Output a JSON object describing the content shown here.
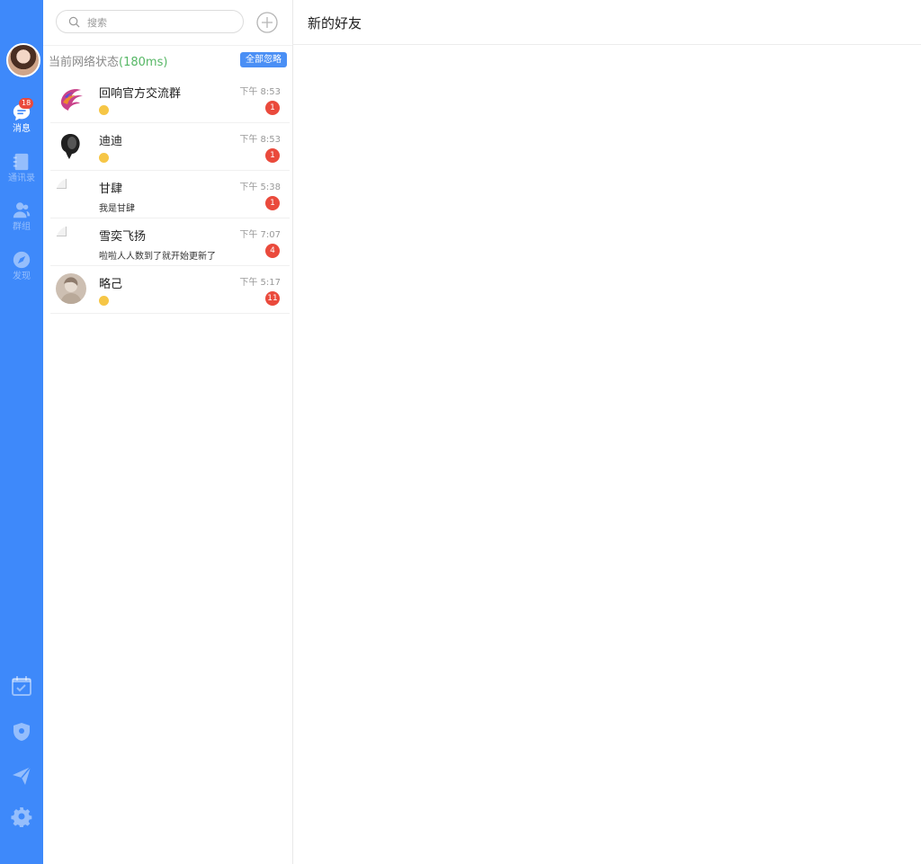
{
  "sidebar": {
    "messages_label": "消息",
    "messages_badge": "18",
    "contacts_label": "通讯录",
    "groups_label": "群组",
    "discover_label": "发现"
  },
  "search": {
    "placeholder": "搜索"
  },
  "network": {
    "label": "当前网络状态",
    "latency": "(180ms)",
    "ignore_label": "全部忽略"
  },
  "conversations": [
    {
      "name": "回响官方交流群",
      "time": "下午 8:53",
      "message": "",
      "unread": "1",
      "avatar": "phoenix-logo"
    },
    {
      "name": "迪迪",
      "time": "下午 8:53",
      "message": "",
      "unread": "1",
      "avatar": "dark-portrait"
    },
    {
      "name": "甘肆",
      "time": "下午 5:38",
      "message": "我是甘肆",
      "unread": "1",
      "avatar": "broken-image"
    },
    {
      "name": "雪奕飞扬",
      "time": "下午 7:07",
      "message": "啦啦人人数到了就开始更新了",
      "unread": "4",
      "avatar": "broken-image"
    },
    {
      "name": "略己",
      "time": "下午 5:17",
      "message": "",
      "unread": "11",
      "avatar": "sketch-portrait"
    }
  ],
  "main": {
    "title": "新的好友"
  }
}
